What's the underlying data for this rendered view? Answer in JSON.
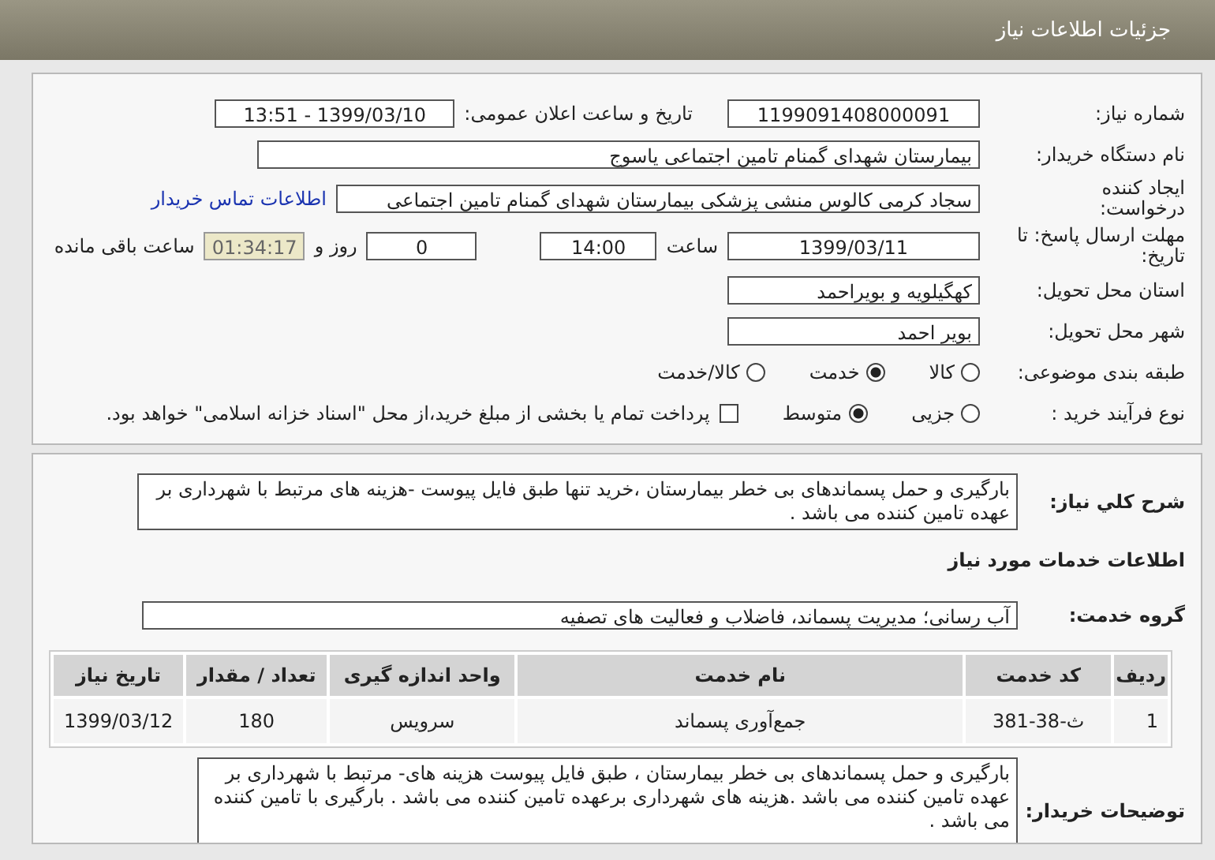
{
  "header": {
    "title": "جزئیات اطلاعات نیاز"
  },
  "need_number": {
    "label": "شماره نیاز:",
    "value": "1199091408000091"
  },
  "announce": {
    "label": "تاریخ و ساعت اعلان عمومی:",
    "value": "1399/03/10 - 13:51"
  },
  "buyer_org": {
    "label": "نام دستگاه خریدار:",
    "value": "بیمارستان شهدای گمنام تامین اجتماعی یاسوج"
  },
  "requester": {
    "label": "ایجاد کننده درخواست:",
    "value": "سجاد کرمی کالوس  منشی پزشکی  بیمارستان شهدای گمنام تامین اجتماعی",
    "link": "اطلاعات تماس خریدار"
  },
  "deadline": {
    "label": "مهلت ارسال پاسخ: تا تاریخ:",
    "date": "1399/03/11",
    "time_label": "ساعت",
    "time": "14:00",
    "days": "0",
    "days_label": "روز و",
    "remaining": "01:34:17",
    "remaining_label": "ساعت باقی مانده"
  },
  "province": {
    "label": "استان محل تحویل:",
    "value": "کهگیلویه و بویراحمد"
  },
  "city": {
    "label": "شهر محل تحویل:",
    "value": "بویر احمد"
  },
  "category": {
    "label": "طبقه بندی موضوعی:",
    "options": [
      {
        "label": "کالا",
        "selected": false
      },
      {
        "label": "خدمت",
        "selected": true
      },
      {
        "label": "کالا/خدمت",
        "selected": false
      }
    ]
  },
  "process": {
    "label": "نوع فرآیند خرید :",
    "options": [
      {
        "label": "جزیی",
        "selected": false
      },
      {
        "label": "متوسط",
        "selected": true
      }
    ],
    "payment": {
      "label": "پرداخت تمام یا بخشی از مبلغ خرید،از محل \"اسناد خزانه اسلامی\" خواهد بود.",
      "checked": false
    }
  },
  "description": {
    "label": "شرح کلي نیاز:",
    "value": "بارگیری و حمل پسماندهای بی خطر بیمارستان ،خرید تنها طبق فایل پیوست -هزینه های مرتبط با شهرداری بر عهده تامین کننده می باشد ."
  },
  "services_heading": "اطلاعات خدمات مورد نیاز",
  "service_group": {
    "label": "گروه خدمت:",
    "value": "آب رسانی؛ مدیریت پسماند، فاضلاب و فعالیت های تصفیه"
  },
  "table": {
    "columns": [
      "ردیف",
      "کد خدمت",
      "نام خدمت",
      "واحد اندازه گیری",
      "تعداد / مقدار",
      "تاریخ نیاز"
    ],
    "rows": [
      [
        "1",
        "ث-38-381",
        "جمع‌آوری پسماند",
        "سرویس",
        "180",
        "1399/03/12"
      ]
    ]
  },
  "buyer_notes": {
    "label": "توضیحات خریدار:",
    "value": "بارگیری و حمل پسماندهای بی خطر بیمارستان ، طبق فایل پیوست هزینه های- مرتبط با شهرداری بر عهده تامین کننده می باشد .هزینه های شهرداری برعهده تامین کننده می باشد . بارگیری با تامین کننده می باشد ."
  }
}
